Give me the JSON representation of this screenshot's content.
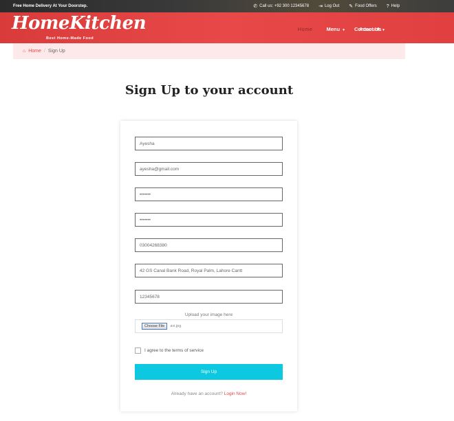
{
  "topbar": {
    "promo": "Free Home Delivery At Your Doorstep.",
    "call": "Call us: +92 300 12345678",
    "logout": "Log Out",
    "offers": "Food Offers",
    "help": "Help"
  },
  "header": {
    "logo": "HomeKitchen",
    "tagline": "Best Home-Made Food",
    "nav": {
      "home": "Home",
      "menu": "Menu",
      "account": "Account",
      "contact": "Contact Us"
    }
  },
  "breadcrumb": {
    "home": "Home",
    "current": "Sign Up"
  },
  "page": {
    "title": "Sign Up to your account"
  },
  "form": {
    "name": "Ayesha",
    "email": "ayesha@gmail.com",
    "password": "•••••••",
    "confirm_password": "•••••••",
    "phone": "03004268380",
    "address": "42 GS Canal Bank Road, Royal Palm, Lahore Cantt",
    "zip": "12345678",
    "upload_label": "Upload your image here",
    "file_button": "Choose File",
    "file_name": "avi.jpg",
    "agree": "I agree to the terms of service",
    "submit": "Sign Up",
    "already": "Already have an account?",
    "login": "Login Now!"
  },
  "colors": {
    "header_red": "#e84848",
    "button_cyan": "#0cc8e0",
    "breadcrumb_bg": "#fde9e9"
  }
}
